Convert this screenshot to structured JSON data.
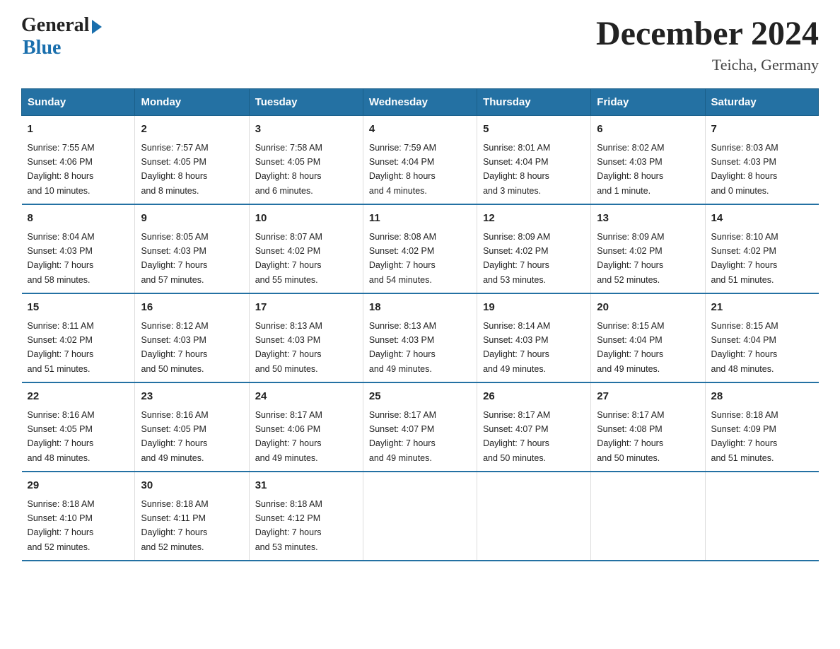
{
  "logo": {
    "general": "General",
    "blue": "Blue"
  },
  "title": "December 2024",
  "subtitle": "Teicha, Germany",
  "days_of_week": [
    "Sunday",
    "Monday",
    "Tuesday",
    "Wednesday",
    "Thursday",
    "Friday",
    "Saturday"
  ],
  "weeks": [
    [
      {
        "day": "1",
        "info": "Sunrise: 7:55 AM\nSunset: 4:06 PM\nDaylight: 8 hours\nand 10 minutes."
      },
      {
        "day": "2",
        "info": "Sunrise: 7:57 AM\nSunset: 4:05 PM\nDaylight: 8 hours\nand 8 minutes."
      },
      {
        "day": "3",
        "info": "Sunrise: 7:58 AM\nSunset: 4:05 PM\nDaylight: 8 hours\nand 6 minutes."
      },
      {
        "day": "4",
        "info": "Sunrise: 7:59 AM\nSunset: 4:04 PM\nDaylight: 8 hours\nand 4 minutes."
      },
      {
        "day": "5",
        "info": "Sunrise: 8:01 AM\nSunset: 4:04 PM\nDaylight: 8 hours\nand 3 minutes."
      },
      {
        "day": "6",
        "info": "Sunrise: 8:02 AM\nSunset: 4:03 PM\nDaylight: 8 hours\nand 1 minute."
      },
      {
        "day": "7",
        "info": "Sunrise: 8:03 AM\nSunset: 4:03 PM\nDaylight: 8 hours\nand 0 minutes."
      }
    ],
    [
      {
        "day": "8",
        "info": "Sunrise: 8:04 AM\nSunset: 4:03 PM\nDaylight: 7 hours\nand 58 minutes."
      },
      {
        "day": "9",
        "info": "Sunrise: 8:05 AM\nSunset: 4:03 PM\nDaylight: 7 hours\nand 57 minutes."
      },
      {
        "day": "10",
        "info": "Sunrise: 8:07 AM\nSunset: 4:02 PM\nDaylight: 7 hours\nand 55 minutes."
      },
      {
        "day": "11",
        "info": "Sunrise: 8:08 AM\nSunset: 4:02 PM\nDaylight: 7 hours\nand 54 minutes."
      },
      {
        "day": "12",
        "info": "Sunrise: 8:09 AM\nSunset: 4:02 PM\nDaylight: 7 hours\nand 53 minutes."
      },
      {
        "day": "13",
        "info": "Sunrise: 8:09 AM\nSunset: 4:02 PM\nDaylight: 7 hours\nand 52 minutes."
      },
      {
        "day": "14",
        "info": "Sunrise: 8:10 AM\nSunset: 4:02 PM\nDaylight: 7 hours\nand 51 minutes."
      }
    ],
    [
      {
        "day": "15",
        "info": "Sunrise: 8:11 AM\nSunset: 4:02 PM\nDaylight: 7 hours\nand 51 minutes."
      },
      {
        "day": "16",
        "info": "Sunrise: 8:12 AM\nSunset: 4:03 PM\nDaylight: 7 hours\nand 50 minutes."
      },
      {
        "day": "17",
        "info": "Sunrise: 8:13 AM\nSunset: 4:03 PM\nDaylight: 7 hours\nand 50 minutes."
      },
      {
        "day": "18",
        "info": "Sunrise: 8:13 AM\nSunset: 4:03 PM\nDaylight: 7 hours\nand 49 minutes."
      },
      {
        "day": "19",
        "info": "Sunrise: 8:14 AM\nSunset: 4:03 PM\nDaylight: 7 hours\nand 49 minutes."
      },
      {
        "day": "20",
        "info": "Sunrise: 8:15 AM\nSunset: 4:04 PM\nDaylight: 7 hours\nand 49 minutes."
      },
      {
        "day": "21",
        "info": "Sunrise: 8:15 AM\nSunset: 4:04 PM\nDaylight: 7 hours\nand 48 minutes."
      }
    ],
    [
      {
        "day": "22",
        "info": "Sunrise: 8:16 AM\nSunset: 4:05 PM\nDaylight: 7 hours\nand 48 minutes."
      },
      {
        "day": "23",
        "info": "Sunrise: 8:16 AM\nSunset: 4:05 PM\nDaylight: 7 hours\nand 49 minutes."
      },
      {
        "day": "24",
        "info": "Sunrise: 8:17 AM\nSunset: 4:06 PM\nDaylight: 7 hours\nand 49 minutes."
      },
      {
        "day": "25",
        "info": "Sunrise: 8:17 AM\nSunset: 4:07 PM\nDaylight: 7 hours\nand 49 minutes."
      },
      {
        "day": "26",
        "info": "Sunrise: 8:17 AM\nSunset: 4:07 PM\nDaylight: 7 hours\nand 50 minutes."
      },
      {
        "day": "27",
        "info": "Sunrise: 8:17 AM\nSunset: 4:08 PM\nDaylight: 7 hours\nand 50 minutes."
      },
      {
        "day": "28",
        "info": "Sunrise: 8:18 AM\nSunset: 4:09 PM\nDaylight: 7 hours\nand 51 minutes."
      }
    ],
    [
      {
        "day": "29",
        "info": "Sunrise: 8:18 AM\nSunset: 4:10 PM\nDaylight: 7 hours\nand 52 minutes."
      },
      {
        "day": "30",
        "info": "Sunrise: 8:18 AM\nSunset: 4:11 PM\nDaylight: 7 hours\nand 52 minutes."
      },
      {
        "day": "31",
        "info": "Sunrise: 8:18 AM\nSunset: 4:12 PM\nDaylight: 7 hours\nand 53 minutes."
      },
      {
        "day": "",
        "info": ""
      },
      {
        "day": "",
        "info": ""
      },
      {
        "day": "",
        "info": ""
      },
      {
        "day": "",
        "info": ""
      }
    ]
  ]
}
